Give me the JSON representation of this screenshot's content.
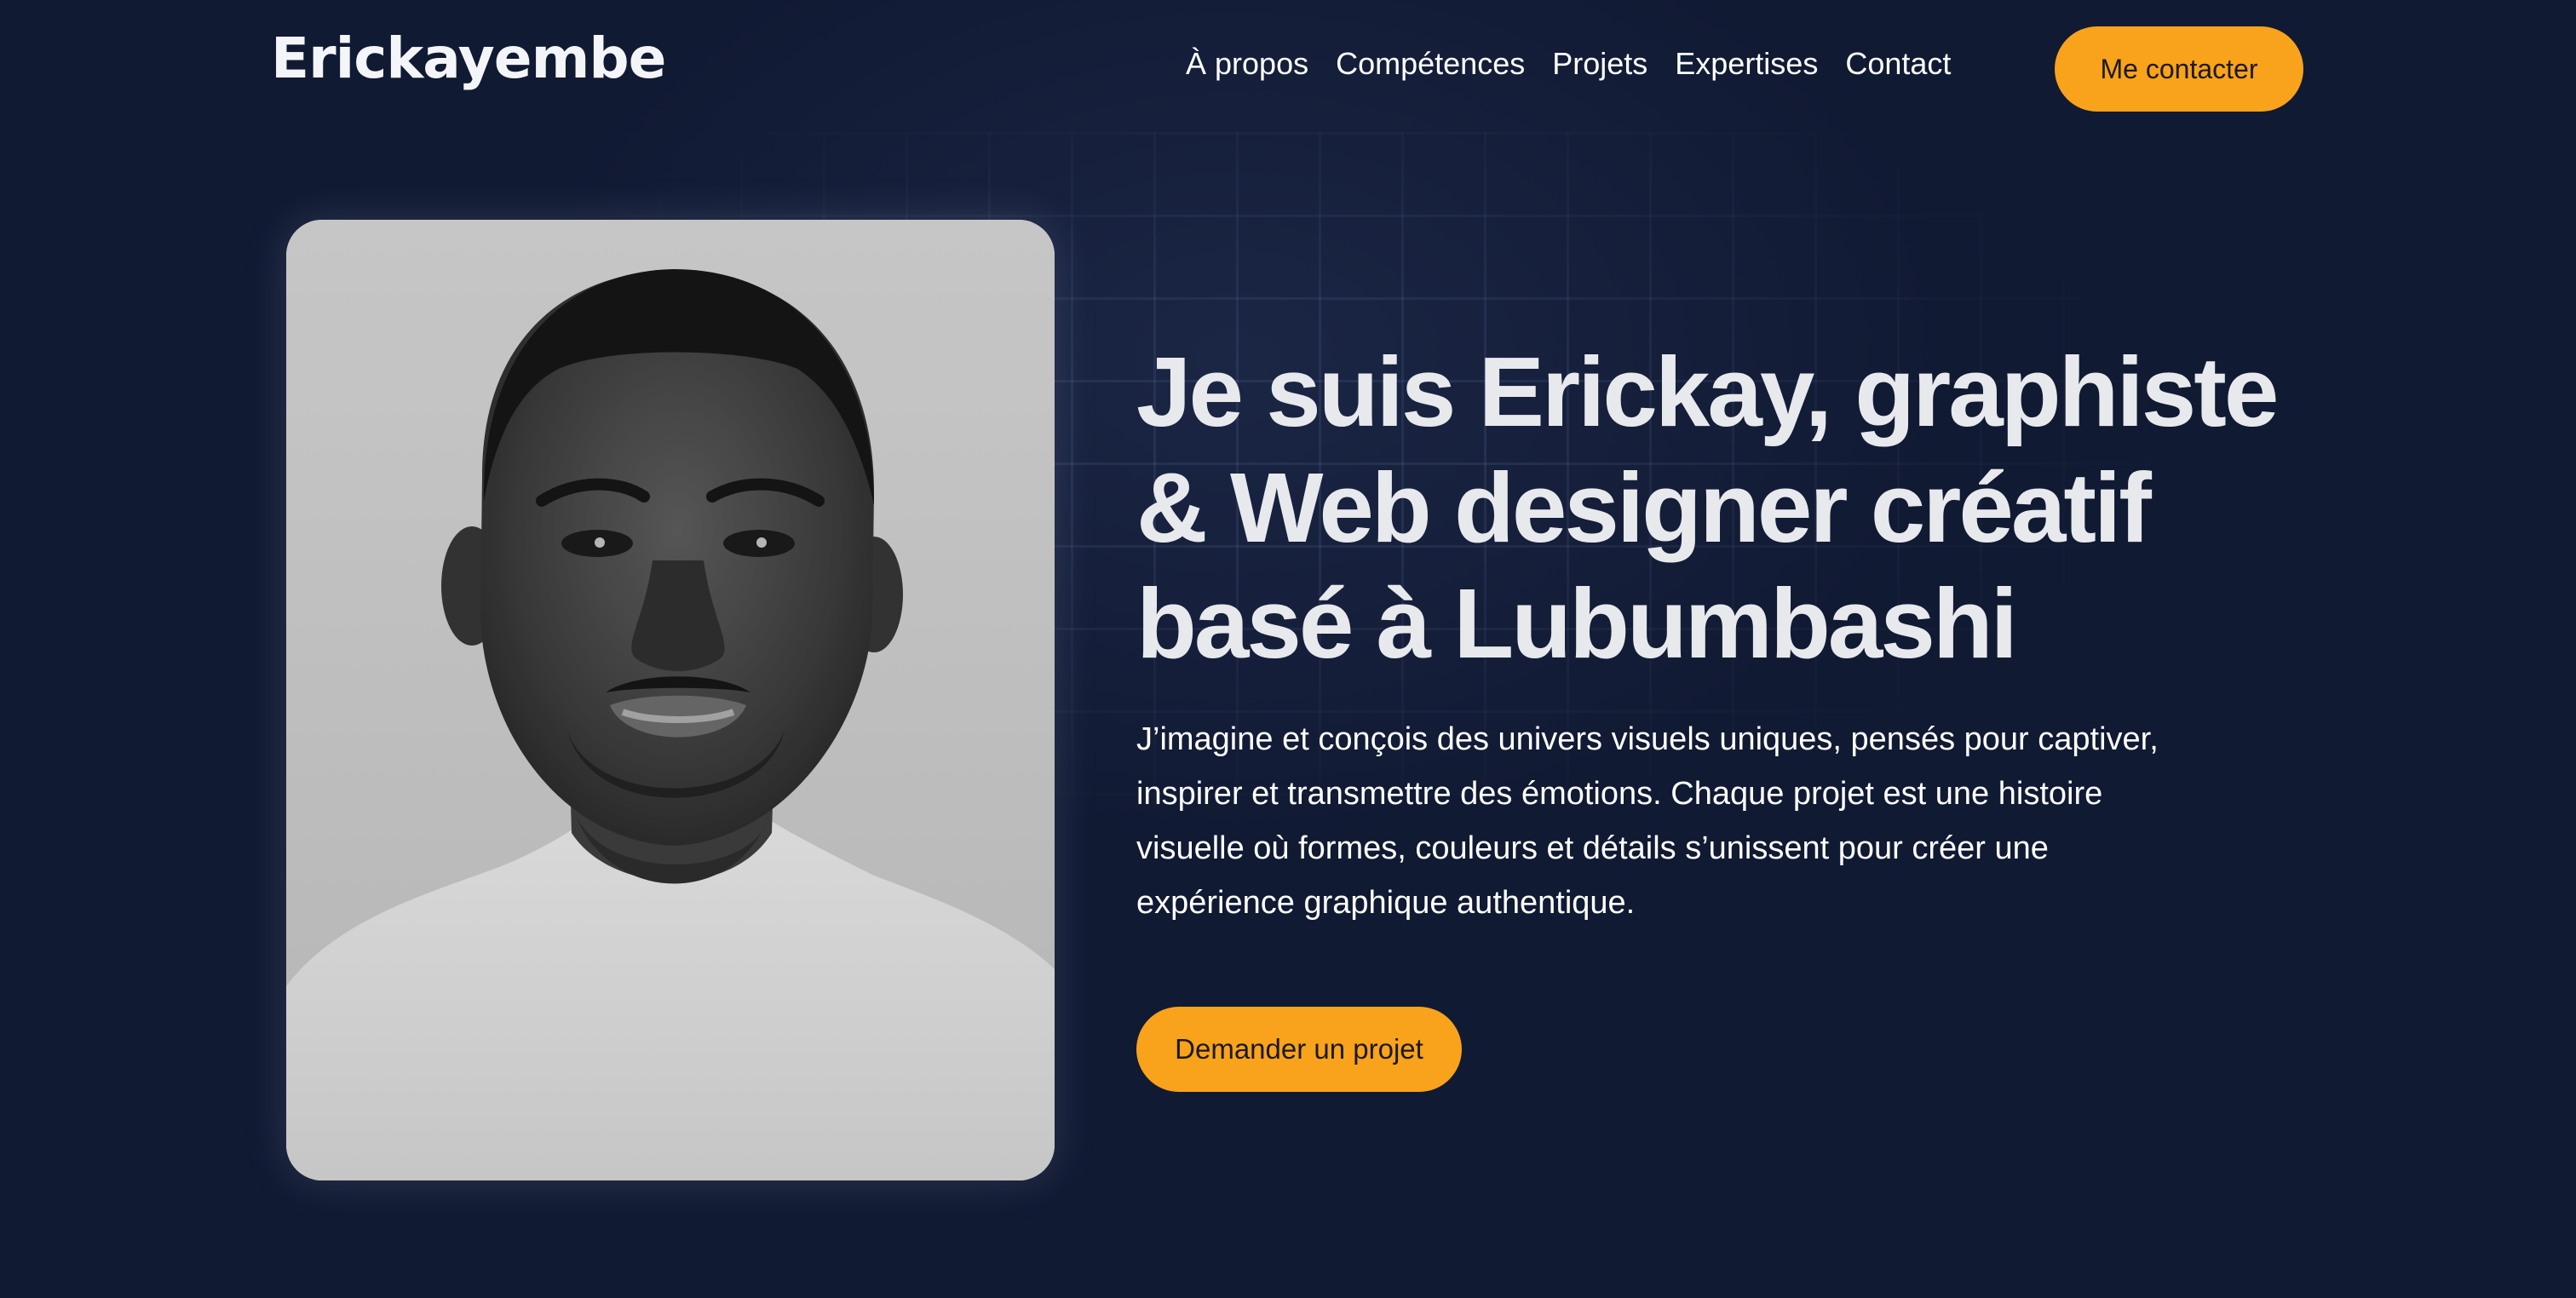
{
  "brand": {
    "logo_text": "Erickayembe"
  },
  "nav": {
    "items": [
      {
        "label": "À propos"
      },
      {
        "label": "Compétences"
      },
      {
        "label": "Projets"
      },
      {
        "label": "Expertises"
      },
      {
        "label": "Contact"
      }
    ],
    "contact_button_label": "Me contacter"
  },
  "hero": {
    "title": "Je suis Erickay, graphiste & Web designer créatif basé à Lubumbashi",
    "description": "J’imagine et conçois des univers visuels uniques, pensés pour captiver, inspirer et transmettre des émotions. Chaque projet est une histoire visuelle où formes, couleurs et détails s’unissent pour créer une expérience graphique authentique.",
    "cta_label": "Demander un projet"
  },
  "colors": {
    "background": "#111a33",
    "accent": "#f9a21b",
    "text": "#e8e9ed"
  }
}
